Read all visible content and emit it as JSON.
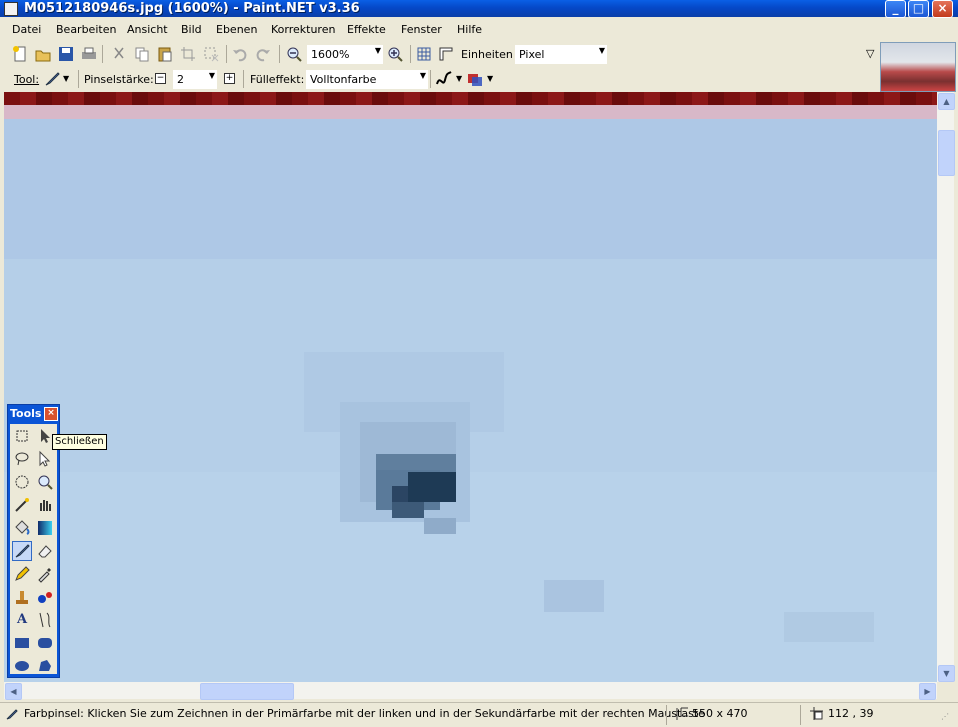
{
  "window": {
    "title": "M0512180946s.jpg (1600%) - Paint.NET v3.36"
  },
  "menu": [
    "Datei",
    "Bearbeiten",
    "Ansicht",
    "Bild",
    "Ebenen",
    "Korrekturen",
    "Effekte",
    "Fenster",
    "Hilfe"
  ],
  "toolbar1": {
    "zoom_value": "1600%",
    "units_label": "Einheiten:",
    "units_value": "Pixel"
  },
  "toolbar2": {
    "tool_label": "Tool:",
    "brush_label": "Pinselstärke:",
    "brush_value": "2",
    "fill_label": "Fülleffekt:",
    "fill_value": "Volltonfarbe"
  },
  "tools_window": {
    "title": "Tools",
    "tooltip": "Schließen"
  },
  "status": {
    "message": "Farbpinsel: Klicken Sie zum Zeichnen in der Primärfarbe mit der linken und in der Sekundärfarbe mit der rechten Maustaste",
    "image_size": "550 x 470",
    "cursor_pos": "112 , 39"
  },
  "colors": {
    "titlebar": "#0548c8",
    "canvas_bg": "#b5cfe8",
    "dark_blob": "#1e3a55"
  }
}
